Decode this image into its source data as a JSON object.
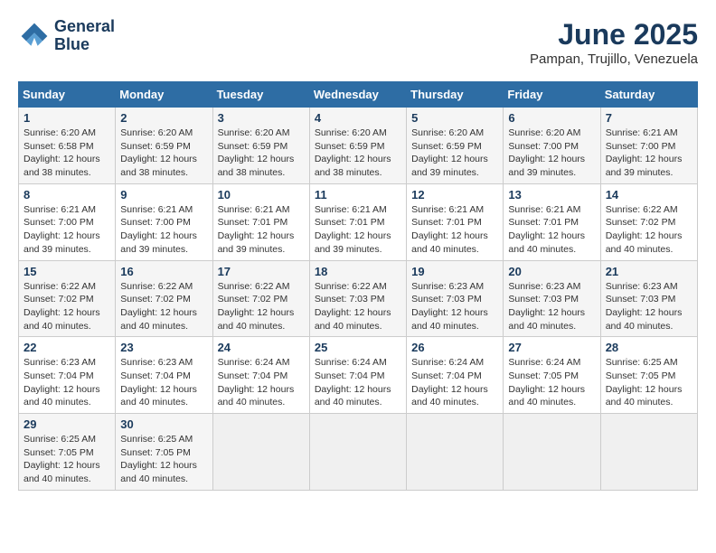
{
  "header": {
    "logo_line1": "General",
    "logo_line2": "Blue",
    "title": "June 2025",
    "subtitle": "Pampan, Trujillo, Venezuela"
  },
  "weekdays": [
    "Sunday",
    "Monday",
    "Tuesday",
    "Wednesday",
    "Thursday",
    "Friday",
    "Saturday"
  ],
  "weeks": [
    [
      {
        "day": "1",
        "sunrise": "6:20 AM",
        "sunset": "6:58 PM",
        "daylight": "12 hours and 38 minutes."
      },
      {
        "day": "2",
        "sunrise": "6:20 AM",
        "sunset": "6:59 PM",
        "daylight": "12 hours and 38 minutes."
      },
      {
        "day": "3",
        "sunrise": "6:20 AM",
        "sunset": "6:59 PM",
        "daylight": "12 hours and 38 minutes."
      },
      {
        "day": "4",
        "sunrise": "6:20 AM",
        "sunset": "6:59 PM",
        "daylight": "12 hours and 38 minutes."
      },
      {
        "day": "5",
        "sunrise": "6:20 AM",
        "sunset": "6:59 PM",
        "daylight": "12 hours and 39 minutes."
      },
      {
        "day": "6",
        "sunrise": "6:20 AM",
        "sunset": "7:00 PM",
        "daylight": "12 hours and 39 minutes."
      },
      {
        "day": "7",
        "sunrise": "6:21 AM",
        "sunset": "7:00 PM",
        "daylight": "12 hours and 39 minutes."
      }
    ],
    [
      {
        "day": "8",
        "sunrise": "6:21 AM",
        "sunset": "7:00 PM",
        "daylight": "12 hours and 39 minutes."
      },
      {
        "day": "9",
        "sunrise": "6:21 AM",
        "sunset": "7:00 PM",
        "daylight": "12 hours and 39 minutes."
      },
      {
        "day": "10",
        "sunrise": "6:21 AM",
        "sunset": "7:01 PM",
        "daylight": "12 hours and 39 minutes."
      },
      {
        "day": "11",
        "sunrise": "6:21 AM",
        "sunset": "7:01 PM",
        "daylight": "12 hours and 39 minutes."
      },
      {
        "day": "12",
        "sunrise": "6:21 AM",
        "sunset": "7:01 PM",
        "daylight": "12 hours and 40 minutes."
      },
      {
        "day": "13",
        "sunrise": "6:21 AM",
        "sunset": "7:01 PM",
        "daylight": "12 hours and 40 minutes."
      },
      {
        "day": "14",
        "sunrise": "6:22 AM",
        "sunset": "7:02 PM",
        "daylight": "12 hours and 40 minutes."
      }
    ],
    [
      {
        "day": "15",
        "sunrise": "6:22 AM",
        "sunset": "7:02 PM",
        "daylight": "12 hours and 40 minutes."
      },
      {
        "day": "16",
        "sunrise": "6:22 AM",
        "sunset": "7:02 PM",
        "daylight": "12 hours and 40 minutes."
      },
      {
        "day": "17",
        "sunrise": "6:22 AM",
        "sunset": "7:02 PM",
        "daylight": "12 hours and 40 minutes."
      },
      {
        "day": "18",
        "sunrise": "6:22 AM",
        "sunset": "7:03 PM",
        "daylight": "12 hours and 40 minutes."
      },
      {
        "day": "19",
        "sunrise": "6:23 AM",
        "sunset": "7:03 PM",
        "daylight": "12 hours and 40 minutes."
      },
      {
        "day": "20",
        "sunrise": "6:23 AM",
        "sunset": "7:03 PM",
        "daylight": "12 hours and 40 minutes."
      },
      {
        "day": "21",
        "sunrise": "6:23 AM",
        "sunset": "7:03 PM",
        "daylight": "12 hours and 40 minutes."
      }
    ],
    [
      {
        "day": "22",
        "sunrise": "6:23 AM",
        "sunset": "7:04 PM",
        "daylight": "12 hours and 40 minutes."
      },
      {
        "day": "23",
        "sunrise": "6:23 AM",
        "sunset": "7:04 PM",
        "daylight": "12 hours and 40 minutes."
      },
      {
        "day": "24",
        "sunrise": "6:24 AM",
        "sunset": "7:04 PM",
        "daylight": "12 hours and 40 minutes."
      },
      {
        "day": "25",
        "sunrise": "6:24 AM",
        "sunset": "7:04 PM",
        "daylight": "12 hours and 40 minutes."
      },
      {
        "day": "26",
        "sunrise": "6:24 AM",
        "sunset": "7:04 PM",
        "daylight": "12 hours and 40 minutes."
      },
      {
        "day": "27",
        "sunrise": "6:24 AM",
        "sunset": "7:05 PM",
        "daylight": "12 hours and 40 minutes."
      },
      {
        "day": "28",
        "sunrise": "6:25 AM",
        "sunset": "7:05 PM",
        "daylight": "12 hours and 40 minutes."
      }
    ],
    [
      {
        "day": "29",
        "sunrise": "6:25 AM",
        "sunset": "7:05 PM",
        "daylight": "12 hours and 40 minutes."
      },
      {
        "day": "30",
        "sunrise": "6:25 AM",
        "sunset": "7:05 PM",
        "daylight": "12 hours and 40 minutes."
      },
      null,
      null,
      null,
      null,
      null
    ]
  ]
}
